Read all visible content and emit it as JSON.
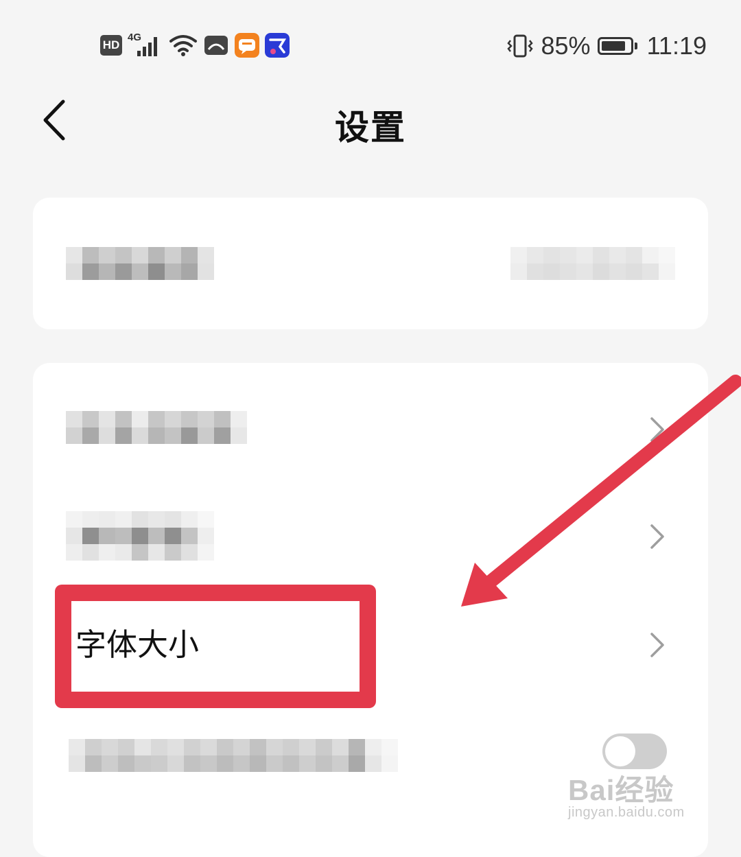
{
  "status_bar": {
    "hd": "HD",
    "network": "4G",
    "battery_percent": "85%",
    "battery_level": 0.85,
    "time": "11:19",
    "app_icons": [
      "liepin-app-icon",
      "zhaopin-app-icon"
    ]
  },
  "header": {
    "title": "设置"
  },
  "settings": {
    "font_size_label": "字体大小"
  },
  "watermark": {
    "main": "Bai经验",
    "sub": "jingyan.baidu.com"
  },
  "colors": {
    "highlight": "#e33a4b",
    "background": "#f5f5f5",
    "card": "#ffffff"
  }
}
